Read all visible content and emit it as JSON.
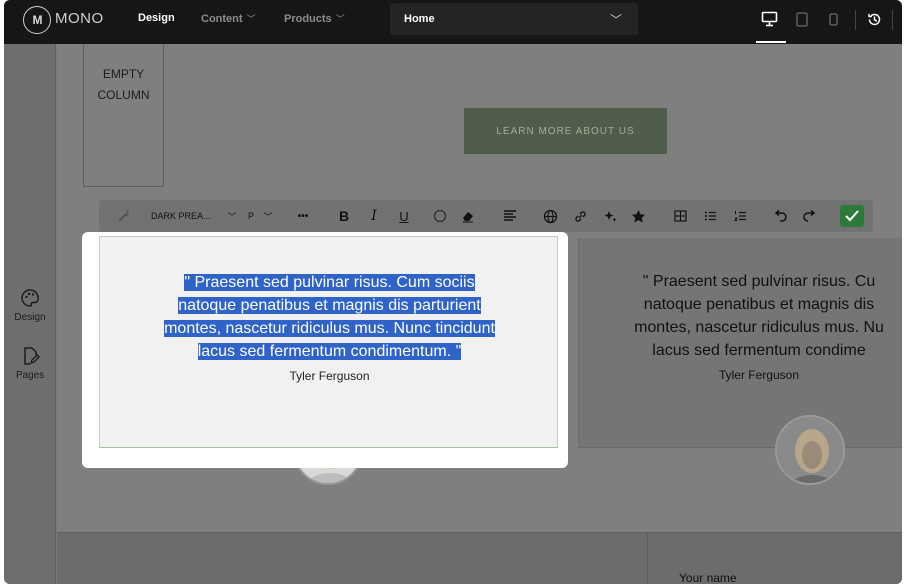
{
  "topbar": {
    "logo_mark": "M",
    "logo_text": "MONO",
    "nav": [
      {
        "label": "Design",
        "active": true
      },
      {
        "label": "Content",
        "active": false
      },
      {
        "label": "Products",
        "active": false
      }
    ],
    "page_select": "Home",
    "devices": [
      "desktop-icon",
      "tablet-icon",
      "mobile-icon"
    ],
    "history_icon": "history-icon"
  },
  "sidebar": {
    "items": [
      {
        "label": "Design",
        "icon": "palette-icon"
      },
      {
        "label": "Pages",
        "icon": "page-edit-icon"
      }
    ]
  },
  "canvas": {
    "empty_column": "EMPTY COLUMN",
    "learn_button": "LEARN MORE ABOUT US",
    "testimonials": [
      {
        "quote": "\" Praesent sed pulvinar risus. Cum sociis natoque penatibus et magnis dis parturient montes, nascetur ridiculus mus. Nunc tincidunt lacus sed fermentum condimentum. \"",
        "quote_lines": [
          "\" Praesent sed pulvinar risus. Cum sociis",
          "natoque penatibus et magnis dis parturient",
          "montes, nascetur ridiculus mus. Nunc tincidunt",
          "lacus sed fermentum condimentum. \""
        ],
        "author": "Tyler Ferguson"
      },
      {
        "quote_lines": [
          "\" Praesent sed pulvinar risus. Cu",
          "natoque penatibus et magnis dis",
          "montes, nascetur ridiculus mus. Nu",
          "lacus sed fermentum condime"
        ],
        "author": "Tyler Ferguson"
      }
    ],
    "form_label": "Your name"
  },
  "toolbar": {
    "style_select": "DARK PREA...",
    "tag_select": "P",
    "more": "•••",
    "bold": "B",
    "italic": "I",
    "underline": "U"
  },
  "colors": {
    "selection": "#2f63c8",
    "confirm": "#2b7a3a",
    "button_green": "#4f5d4a"
  }
}
